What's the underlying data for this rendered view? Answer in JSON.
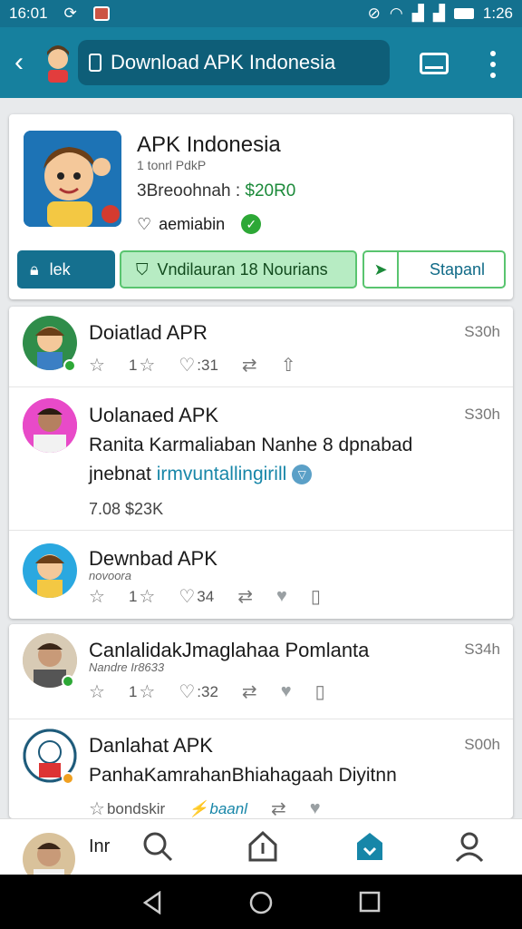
{
  "status": {
    "time_left": "16:01",
    "time_right": "1:26"
  },
  "appbar": {
    "url": "Download APK Indonesia"
  },
  "app_card": {
    "title": "APK Indonesia",
    "subtitle": "1 tonrl PdkP",
    "price_label": "3Breoohnah :",
    "price_value": "$20R0",
    "meta": "aemiabin",
    "btn_lock": "lek",
    "btn_download": "Vndilauran 18 Nourians",
    "btn_share": "Stapanl"
  },
  "feed": [
    {
      "title": "Doiatlad APR",
      "time": "S30h",
      "rating": "1",
      "comments": ":31"
    },
    {
      "title": "Uolanaed APK",
      "time": "S30h",
      "body1": "Ranita Karmaliaban Nanhe 8 dpnabad",
      "body2_plain": "jnebnat",
      "body2_link": "irmvuntallingirill",
      "stats": "7.08 $23K"
    },
    {
      "title": "Dewnbad APK",
      "subtitle": "novoora",
      "rating": "1",
      "comments": "34"
    }
  ],
  "feed2": [
    {
      "title": "CanlalidakJmaglahaa Pomlanta",
      "time": "S34h",
      "subtitle": "Nandre Ir8633",
      "rating": "1",
      "comments": ":32"
    },
    {
      "title": "Danlahat APK",
      "time": "S00h",
      "body1": "PanhaKamrahanBhiahagaah Diyitnn",
      "meta_plain": "bondskir",
      "meta_link": "baanl"
    }
  ],
  "peek": {
    "text": "Inr"
  },
  "colors": {
    "brand": "#16809e",
    "accent_green": "#59c46f",
    "link": "#1786a8"
  }
}
